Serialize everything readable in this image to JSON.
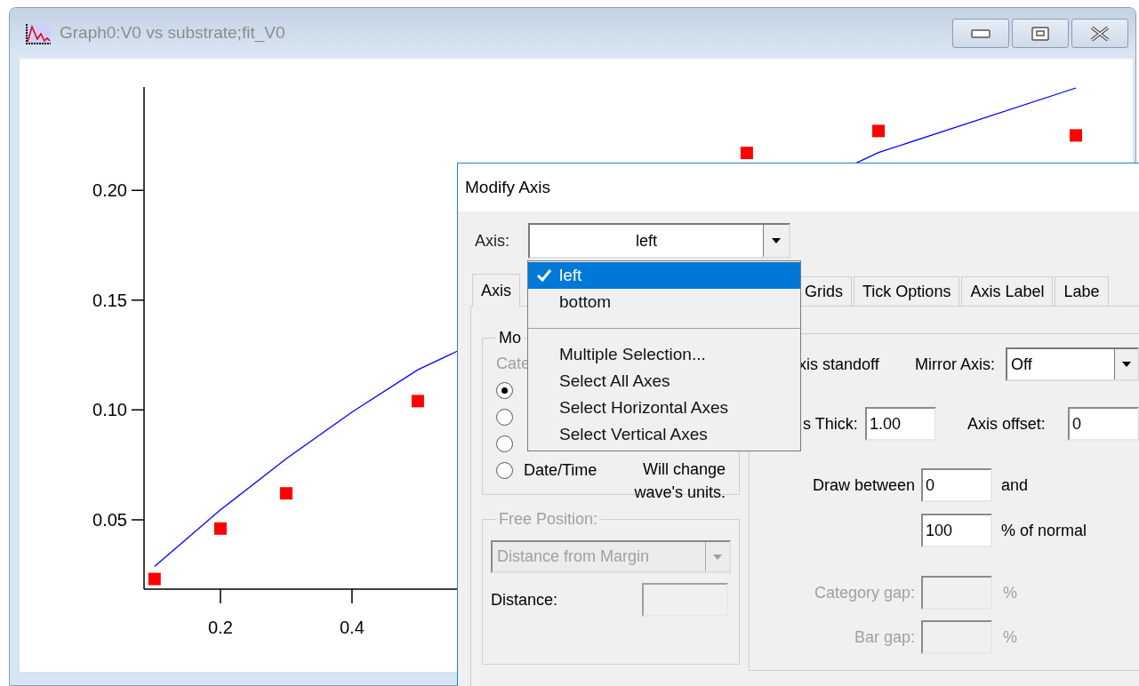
{
  "graph_window": {
    "title": "Graph0:V0 vs substrate;fit_V0",
    "active": false,
    "chart_data": {
      "type": "scatter",
      "x": [
        0.1,
        0.2,
        0.3,
        0.4,
        0.5,
        1.0,
        1.2,
        1.5
      ],
      "series": [
        {
          "type": "scatter",
          "color": "#ff0000",
          "values": [
            0.023,
            0.046,
            0.062,
            null,
            0.104,
            0.217,
            0.227,
            0.225
          ]
        },
        {
          "type": "line",
          "color": "#0000ff",
          "values": [
            0.0287,
            0.0545,
            0.0778,
            0.099,
            0.1183,
            null,
            0.2172,
            0.2466
          ]
        }
      ],
      "xlim": [
        0.084,
        1.5
      ],
      "ylim": [
        0.0184,
        0.247
      ],
      "xticks": [
        {
          "value": 0.2,
          "label": "0.2"
        },
        {
          "value": 0.4,
          "label": "0.4"
        }
      ],
      "yticks": [
        {
          "value": 0.05,
          "label": "0.05"
        },
        {
          "value": 0.1,
          "label": "0.10"
        },
        {
          "value": 0.15,
          "label": "0.15"
        },
        {
          "value": 0.2,
          "label": "0.20"
        }
      ]
    }
  },
  "dialog": {
    "title": "Modify Axis",
    "axis_label": "Axis:",
    "axis_value": "left",
    "axis_menu": {
      "items": [
        {
          "label": "left",
          "selected": true
        },
        {
          "label": "bottom",
          "selected": false
        }
      ],
      "commands": [
        "Multiple Selection...",
        "Select All Axes",
        "Select Horizontal Axes",
        "Select Vertical Axes"
      ]
    },
    "tabs": [
      {
        "label": "Axis",
        "selected": true
      },
      {
        "label": "Grids",
        "selected": false
      },
      {
        "label": "Tick Options",
        "selected": false
      },
      {
        "label": "Axis Label",
        "selected": false
      },
      {
        "label": "Labe",
        "selected": false
      }
    ],
    "mode_group": {
      "title": "Mo",
      "hint": "Cate",
      "options": [
        {
          "selected": true
        },
        {
          "selected": false
        },
        {
          "selected": false
        },
        {
          "label": "Date/Time",
          "selected": false
        }
      ],
      "note": [
        "Will change",
        "wave's units."
      ]
    },
    "free_position": {
      "title": "Free Position:",
      "mode": "Distance from Margin",
      "distance_label": "Distance:",
      "disabled": true
    },
    "settings": {
      "standoff_label": "xis standoff",
      "mirror_label": "Mirror Axis:",
      "mirror_value": "Off",
      "thick_label": "s Thick:",
      "thick_value": "1.00",
      "offset_label": "Axis offset:",
      "offset_value": "0",
      "draw_between_label": "Draw between",
      "from_value": "0",
      "and_label": "and",
      "to_value": "100",
      "percent_label": "% of normal",
      "gaps": [
        {
          "label": "Category gap:",
          "unit": "%",
          "disabled": true
        },
        {
          "label": "Bar gap:",
          "unit": "%",
          "disabled": true
        }
      ]
    }
  }
}
